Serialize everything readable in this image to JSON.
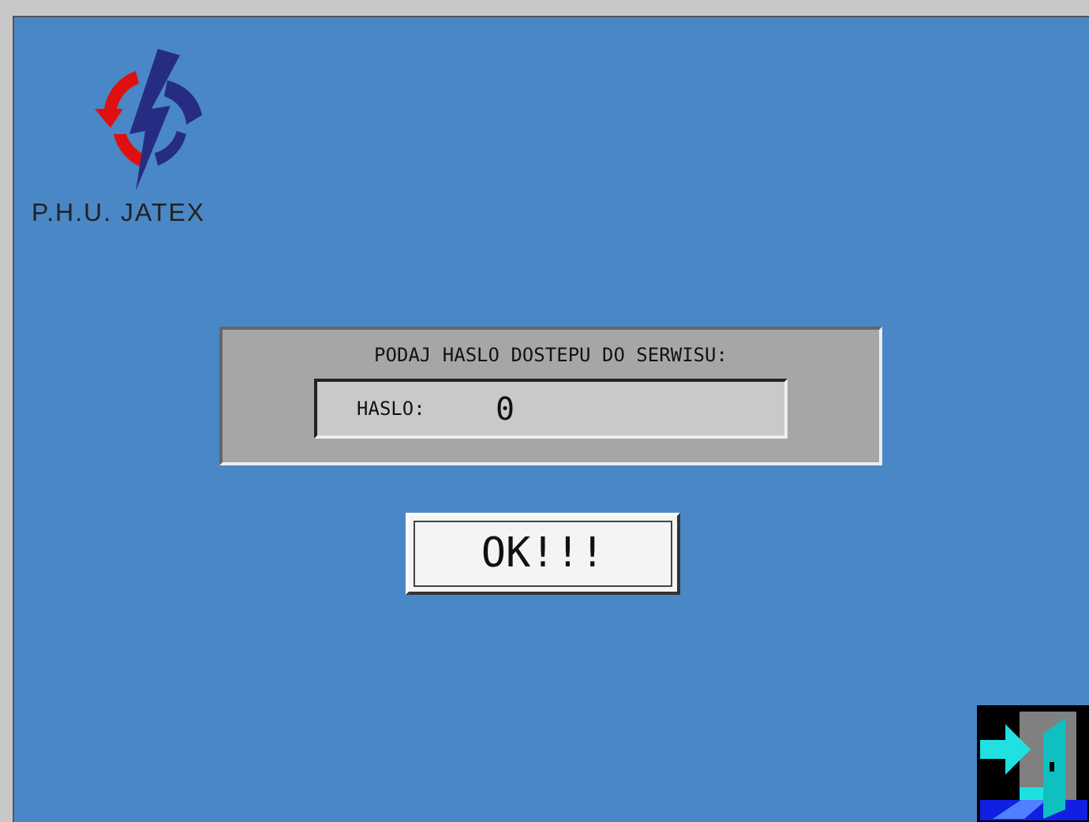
{
  "logo": {
    "text": "P.H.U. JATEX"
  },
  "password_panel": {
    "prompt": "PODAJ HASLO DOSTEPU DO SERWISU:",
    "label": "HASLO:",
    "value": "0"
  },
  "buttons": [
    {
      "label": "OK!!!"
    }
  ]
}
